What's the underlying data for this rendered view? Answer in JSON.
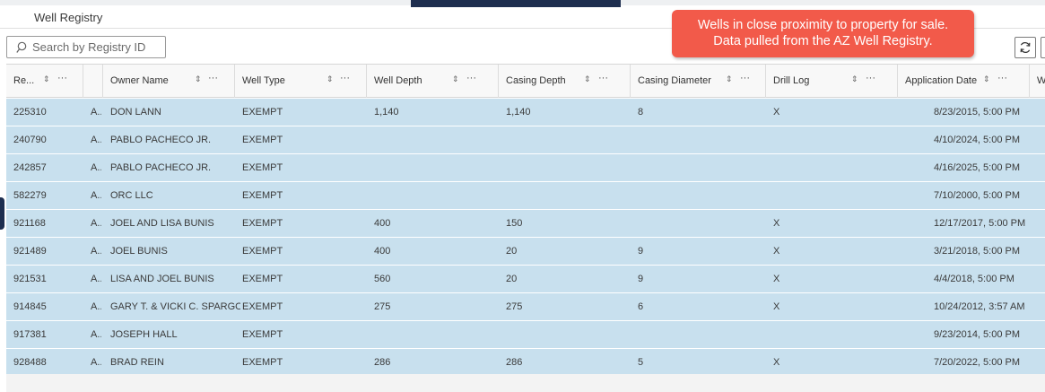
{
  "panel": {
    "title": "Well Registry"
  },
  "search": {
    "placeholder": "Search by Registry ID"
  },
  "callout": {
    "line1": "Wells in close proximity to property for sale.",
    "line2": "Data pulled from the AZ Well Registry."
  },
  "icons": {
    "search": "search-icon",
    "refresh": "refresh-icon",
    "sort": "sort-icon",
    "more": "more-options-icon"
  },
  "colors": {
    "row_selected": "#c8e0ee",
    "callout": "#f25a4a",
    "nav_dark": "#1e2e4f"
  },
  "table": {
    "columns": [
      {
        "label": "Re..."
      },
      {
        "label": ""
      },
      {
        "label": "Owner Name"
      },
      {
        "label": "Well Type"
      },
      {
        "label": "Well Depth"
      },
      {
        "label": "Casing Depth"
      },
      {
        "label": "Casing Diameter"
      },
      {
        "label": "Drill Log"
      },
      {
        "label": "Application Date"
      },
      {
        "label": "W"
      }
    ],
    "sort_glyph": "⇕",
    "more_glyph": "···",
    "rows": [
      {
        "registry": "225310",
        "a": "A..",
        "owner": "DON LANN",
        "type": "EXEMPT",
        "depth": "1,140",
        "casing_depth": "1,140",
        "casing_diameter": "8",
        "drill_log": "X",
        "date": "8/23/2015, 5:00 PM"
      },
      {
        "registry": "240790",
        "a": "A..",
        "owner": "PABLO PACHECO JR.",
        "type": "EXEMPT",
        "depth": "",
        "casing_depth": "",
        "casing_diameter": "",
        "drill_log": "",
        "date": "4/10/2024, 5:00 PM"
      },
      {
        "registry": "242857",
        "a": "A..",
        "owner": "PABLO PACHECO JR.",
        "type": "EXEMPT",
        "depth": "",
        "casing_depth": "",
        "casing_diameter": "",
        "drill_log": "",
        "date": "4/16/2025, 5:00 PM"
      },
      {
        "registry": "582279",
        "a": "A..",
        "owner": "ORC LLC",
        "type": "EXEMPT",
        "depth": "",
        "casing_depth": "",
        "casing_diameter": "",
        "drill_log": "",
        "date": "7/10/2000, 5:00 PM"
      },
      {
        "registry": "921168",
        "a": "A..",
        "owner": "JOEL AND LISA BUNIS",
        "type": "EXEMPT",
        "depth": "400",
        "casing_depth": "150",
        "casing_diameter": "",
        "drill_log": "X",
        "date": "12/17/2017, 5:00 PM"
      },
      {
        "registry": "921489",
        "a": "A..",
        "owner": "JOEL BUNIS",
        "type": "EXEMPT",
        "depth": "400",
        "casing_depth": "20",
        "casing_diameter": "9",
        "drill_log": "X",
        "date": "3/21/2018, 5:00 PM"
      },
      {
        "registry": "921531",
        "a": "A..",
        "owner": "LISA AND JOEL BUNIS",
        "type": "EXEMPT",
        "depth": "560",
        "casing_depth": "20",
        "casing_diameter": "9",
        "drill_log": "X",
        "date": "4/4/2018, 5:00 PM"
      },
      {
        "registry": "914845",
        "a": "A..",
        "owner": "GARY T. & VICKI C. SPARGO",
        "type": "EXEMPT",
        "depth": "275",
        "casing_depth": "275",
        "casing_diameter": "6",
        "drill_log": "X",
        "date": "10/24/2012, 3:57 AM"
      },
      {
        "registry": "917381",
        "a": "A..",
        "owner": "JOSEPH HALL",
        "type": "EXEMPT",
        "depth": "",
        "casing_depth": "",
        "casing_diameter": "",
        "drill_log": "",
        "date": "9/23/2014, 5:00 PM"
      },
      {
        "registry": "928488",
        "a": "A..",
        "owner": "BRAD REIN",
        "type": "EXEMPT",
        "depth": "286",
        "casing_depth": "286",
        "casing_diameter": "5",
        "drill_log": "X",
        "date": "7/20/2022, 5:00 PM"
      }
    ]
  }
}
